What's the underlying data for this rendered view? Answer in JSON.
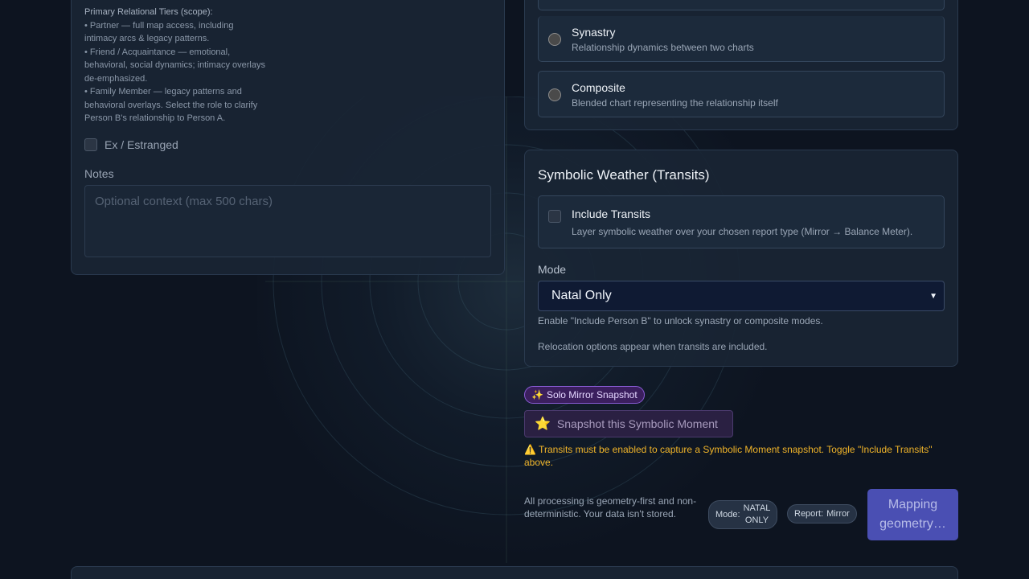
{
  "person_b": {
    "scope_title": "Primary Relational Tiers (scope):",
    "scope_lines": [
      "• Partner — full map access, including",
      "intimacy arcs & legacy patterns.",
      "• Friend / Acquaintance — emotional,",
      "behavioral, social dynamics; intimacy overlays",
      "de-emphasized.",
      "• Family Member — legacy patterns and",
      "behavioral overlays. Select the role to clarify",
      "Person B's relationship to Person A."
    ],
    "ex_label": "Ex / Estranged",
    "notes_label": "Notes",
    "notes_placeholder": "Optional context (max 500 chars)"
  },
  "report_types": [
    {
      "title": "Synastry",
      "desc": "Relationship dynamics between two charts"
    },
    {
      "title": "Composite",
      "desc": "Blended chart representing the relationship itself"
    }
  ],
  "transits": {
    "title": "Symbolic Weather (Transits)",
    "include_title": "Include Transits",
    "include_desc": "Layer symbolic weather over your chosen report type (Mirror → Balance Meter).",
    "mode_label": "Mode",
    "mode_value": "Natal Only",
    "hint_person_b": "Enable \"Include Person B\" to unlock synastry or composite modes.",
    "hint_relocation": "Relocation options appear when transits are included."
  },
  "snapshot": {
    "badge_icon": "✨",
    "badge_label": "Solo Mirror Snapshot",
    "button_icon": "⭐",
    "button_label": "Snapshot this Symbolic Moment",
    "warning": "⚠️ Transits must be enabled to capture a Symbolic Moment snapshot. Toggle \"Include Transits\" above."
  },
  "footer": {
    "note": "All processing is geometry-first and non-deterministic. Your data isn't stored.",
    "mode_key": "Mode:",
    "mode_val_line1": "NATAL",
    "mode_val_line2": "ONLY",
    "report_key": "Report:",
    "report_val": "Mirror",
    "submit_line1": "Mapping",
    "submit_line2": "geometry…"
  },
  "colors": {
    "background": "#0d1420",
    "card": "#192534",
    "accent_purple": "#8a5cd6",
    "warning": "#f0b429",
    "submit": "#4a4fb3"
  }
}
